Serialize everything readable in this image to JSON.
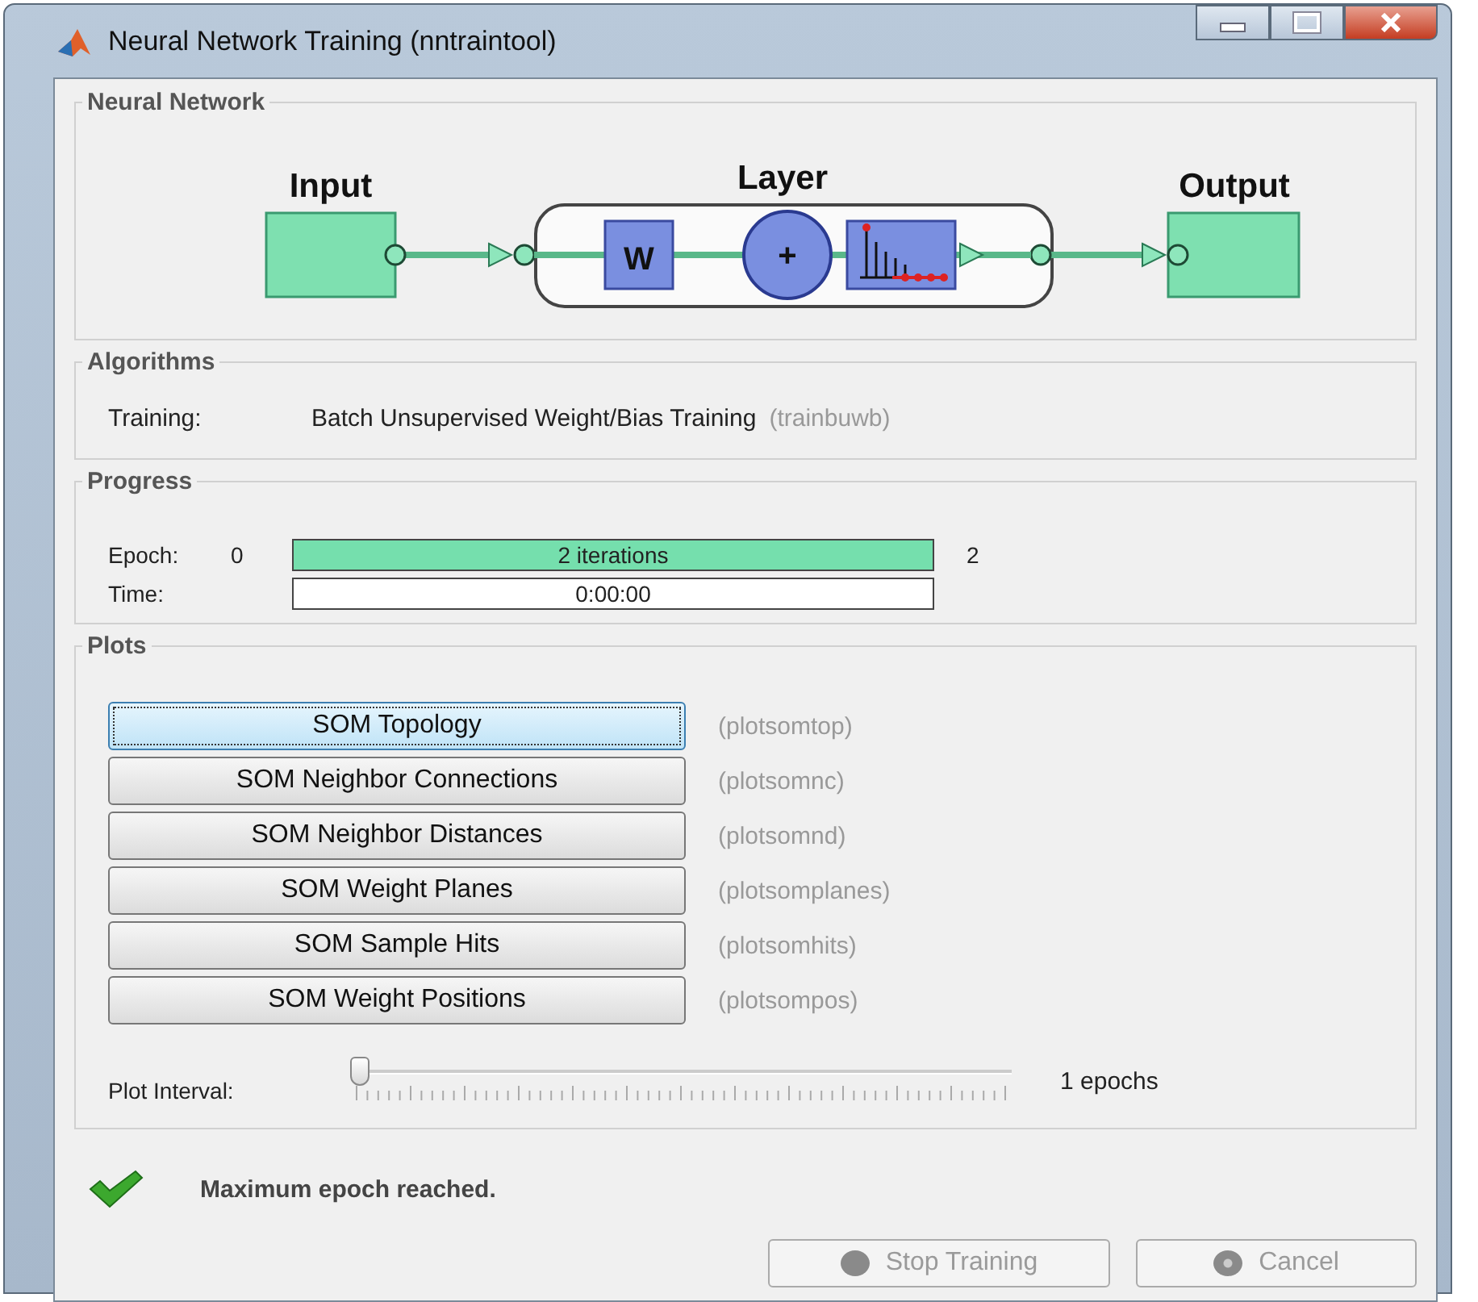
{
  "window": {
    "title": "Neural Network Training (nntraintool)"
  },
  "network": {
    "heading": "Neural Network",
    "input_label": "Input",
    "layer_label": "Layer",
    "weight_label": "W",
    "sum_label": "+",
    "output_label": "Output"
  },
  "algorithms": {
    "heading": "Algorithms",
    "rows": [
      {
        "label": "Training:",
        "value": "Batch Unsupervised Weight/Bias Training",
        "function": "(trainbuwb)"
      }
    ]
  },
  "progress": {
    "heading": "Progress",
    "rows": [
      {
        "label": "Epoch:",
        "start": "0",
        "text": "2 iterations",
        "end": "2",
        "level": 1
      },
      {
        "label": "Time:",
        "text": "0:00:00",
        "level": 0
      }
    ]
  },
  "plots": {
    "heading": "Plots",
    "buttons": [
      {
        "label": "SOM Topology",
        "function": "(plotsomtop)",
        "selected": true
      },
      {
        "label": "SOM Neighbor Connections",
        "function": "(plotsomnc)",
        "selected": false
      },
      {
        "label": "SOM Neighbor Distances",
        "function": "(plotsomnd)",
        "selected": false
      },
      {
        "label": "SOM Weight Planes",
        "function": "(plotsomplanes)",
        "selected": false
      },
      {
        "label": "SOM Sample Hits",
        "function": "(plotsomhits)",
        "selected": false
      },
      {
        "label": "SOM Weight Positions",
        "function": "(plotsompos)",
        "selected": false
      }
    ],
    "interval": {
      "label": "Plot Interval:",
      "level": 0,
      "reading": "1 epochs"
    }
  },
  "status": {
    "message": "Maximum epoch reached."
  },
  "buttons": [
    {
      "label": "Stop Training",
      "kind": "stop",
      "disabled": true
    },
    {
      "label": "Cancel",
      "kind": "cancel",
      "disabled": true
    }
  ]
}
